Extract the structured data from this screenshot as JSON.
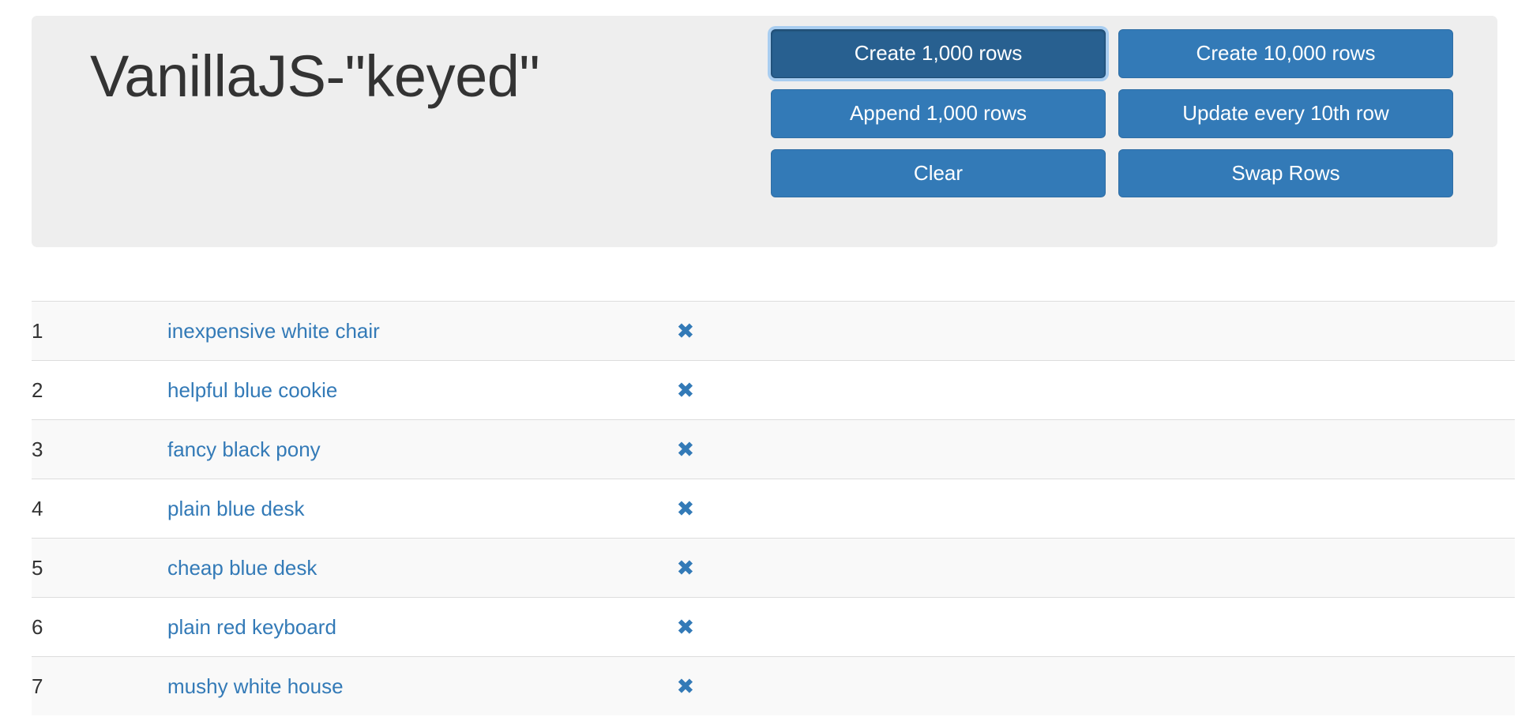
{
  "header": {
    "title": "VanillaJS-\"keyed\"",
    "background_color": "#eeeeee"
  },
  "toolbar": {
    "buttons": [
      {
        "id": "run",
        "label": "Create 1,000 rows",
        "focused": true
      },
      {
        "id": "runlots",
        "label": "Create 10,000 rows",
        "focused": false
      },
      {
        "id": "add",
        "label": "Append 1,000 rows",
        "focused": false
      },
      {
        "id": "update",
        "label": "Update every 10th row",
        "focused": false
      },
      {
        "id": "clear",
        "label": "Clear",
        "focused": false
      },
      {
        "id": "swaprows",
        "label": "Swap Rows",
        "focused": false
      }
    ],
    "primary_color": "#337ab7",
    "focused_color": "#286090",
    "focus_ring_color": "#a8cdf0"
  },
  "table": {
    "remove_icon": "remove-icon",
    "remove_glyph": "✖",
    "link_color": "#337ab7",
    "stripe_color": "#f9f9f9",
    "border_color": "#dddddd",
    "rows": [
      {
        "id": "1",
        "label": "inexpensive white chair"
      },
      {
        "id": "2",
        "label": "helpful blue cookie"
      },
      {
        "id": "3",
        "label": "fancy black pony"
      },
      {
        "id": "4",
        "label": "plain blue desk"
      },
      {
        "id": "5",
        "label": "cheap blue desk"
      },
      {
        "id": "6",
        "label": "plain red keyboard"
      },
      {
        "id": "7",
        "label": "mushy white house"
      }
    ]
  }
}
